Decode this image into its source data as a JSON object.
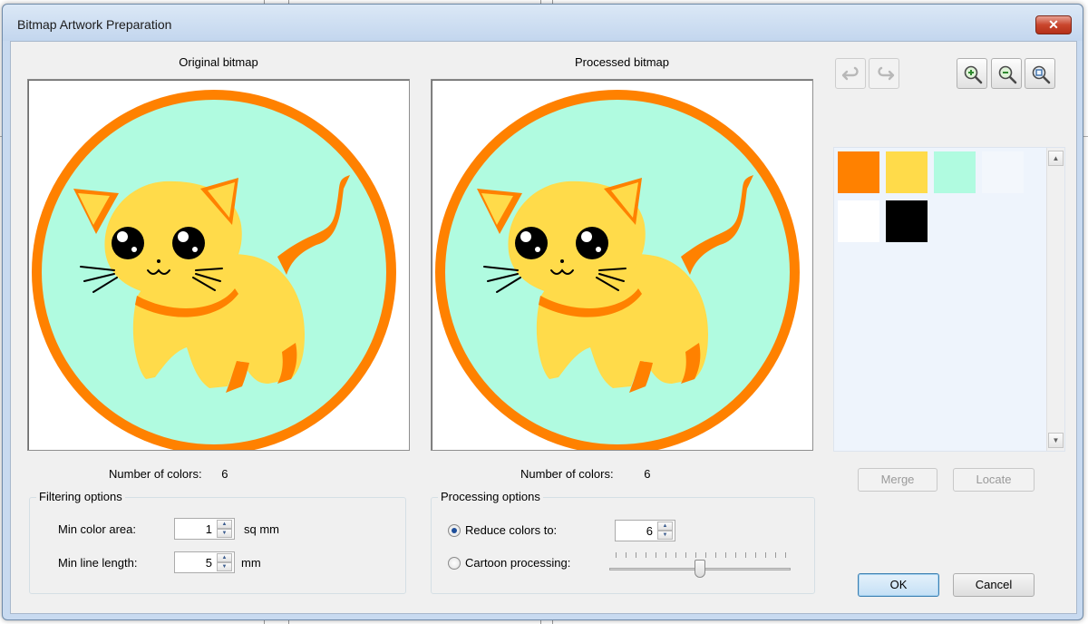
{
  "window": {
    "title": "Bitmap Artwork Preparation",
    "close_label": "✕"
  },
  "original": {
    "label": "Original bitmap",
    "colors_label": "Number of colors:",
    "colors_value": "6"
  },
  "processed": {
    "label": "Processed bitmap",
    "colors_label": "Number of colors:",
    "colors_value": "6"
  },
  "filtering": {
    "title": "Filtering options",
    "min_area_label": "Min color area:",
    "min_area_value": "1",
    "min_area_unit": "sq mm",
    "min_line_label": "Min line length:",
    "min_line_value": "5",
    "min_line_unit": "mm"
  },
  "processing": {
    "title": "Processing options",
    "reduce_label": "Reduce colors to:",
    "reduce_value": "6",
    "reduce_selected": true,
    "cartoon_label": "Cartoon processing:",
    "cartoon_selected": false,
    "cartoon_level": 0.5
  },
  "toolbar": {
    "undo_icon": "undo-icon",
    "redo_icon": "redo-icon",
    "zoom_in_icon": "zoom-in-icon",
    "zoom_out_icon": "zoom-out-icon",
    "zoom_fit_icon": "zoom-fit-icon"
  },
  "palette": {
    "colors": [
      "#ff8100",
      "#ffdb4a",
      "#b0fbe0",
      "#f3f7fc",
      "#ffffff",
      "#000000"
    ]
  },
  "buttons": {
    "merge": "Merge",
    "locate": "Locate",
    "ok": "OK",
    "cancel": "Cancel"
  },
  "artwork": {
    "ring_color": "#ff8100",
    "background_color": "#b0fbe0",
    "cat_color": "#ffdb4a",
    "accent_color": "#ff8100",
    "eye_color": "#000000"
  }
}
